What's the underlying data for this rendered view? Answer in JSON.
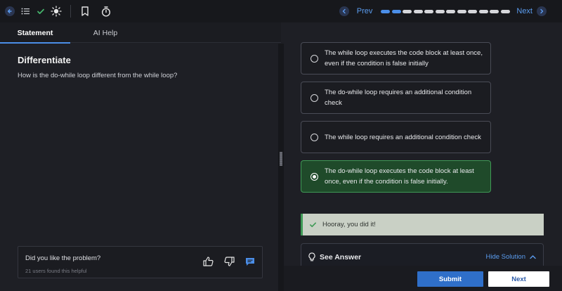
{
  "topbar": {
    "prev_label": "Prev",
    "next_label": "Next",
    "progress": {
      "total": 12,
      "completed": 2
    }
  },
  "tabs": [
    {
      "label": "Statement",
      "active": true
    },
    {
      "label": "AI Help",
      "active": false
    }
  ],
  "problem": {
    "title": "Differentiate",
    "question": "How is the do-while loop different from the while loop?"
  },
  "feedback": {
    "question": "Did you like the problem?",
    "subtext": "21 users found this helpful"
  },
  "options": [
    {
      "text": "The while loop executes the code block at least once, even if the condition is false initially",
      "selected": false
    },
    {
      "text": "The do-while loop requires an additional condition check",
      "selected": false
    },
    {
      "text": "The while loop requires an additional condition check",
      "selected": false
    },
    {
      "text": "The do-while loop executes the code block at least once, even if the condition is false initially.",
      "selected": true
    }
  ],
  "result": {
    "message": "Hooray, you did it!"
  },
  "answer": {
    "title": "See Answer",
    "toggle_label": "Hide Solution"
  },
  "actions": {
    "submit_label": "Submit",
    "next_label": "Next"
  },
  "colors": {
    "accent": "#4b8ee8",
    "success": "#3f9a56",
    "selected_bg": "#1f4a2a",
    "background": "#1e1f25"
  },
  "icons": {
    "back": "back-arrow-icon",
    "list": "list-icon",
    "check": "check-icon",
    "theme": "sun-icon",
    "bookmark": "bookmark-icon",
    "timer": "stopwatch-icon",
    "like": "thumbs-up-icon",
    "dislike": "thumbs-down-icon",
    "comment": "comment-icon",
    "bulb": "lightbulb-icon"
  }
}
